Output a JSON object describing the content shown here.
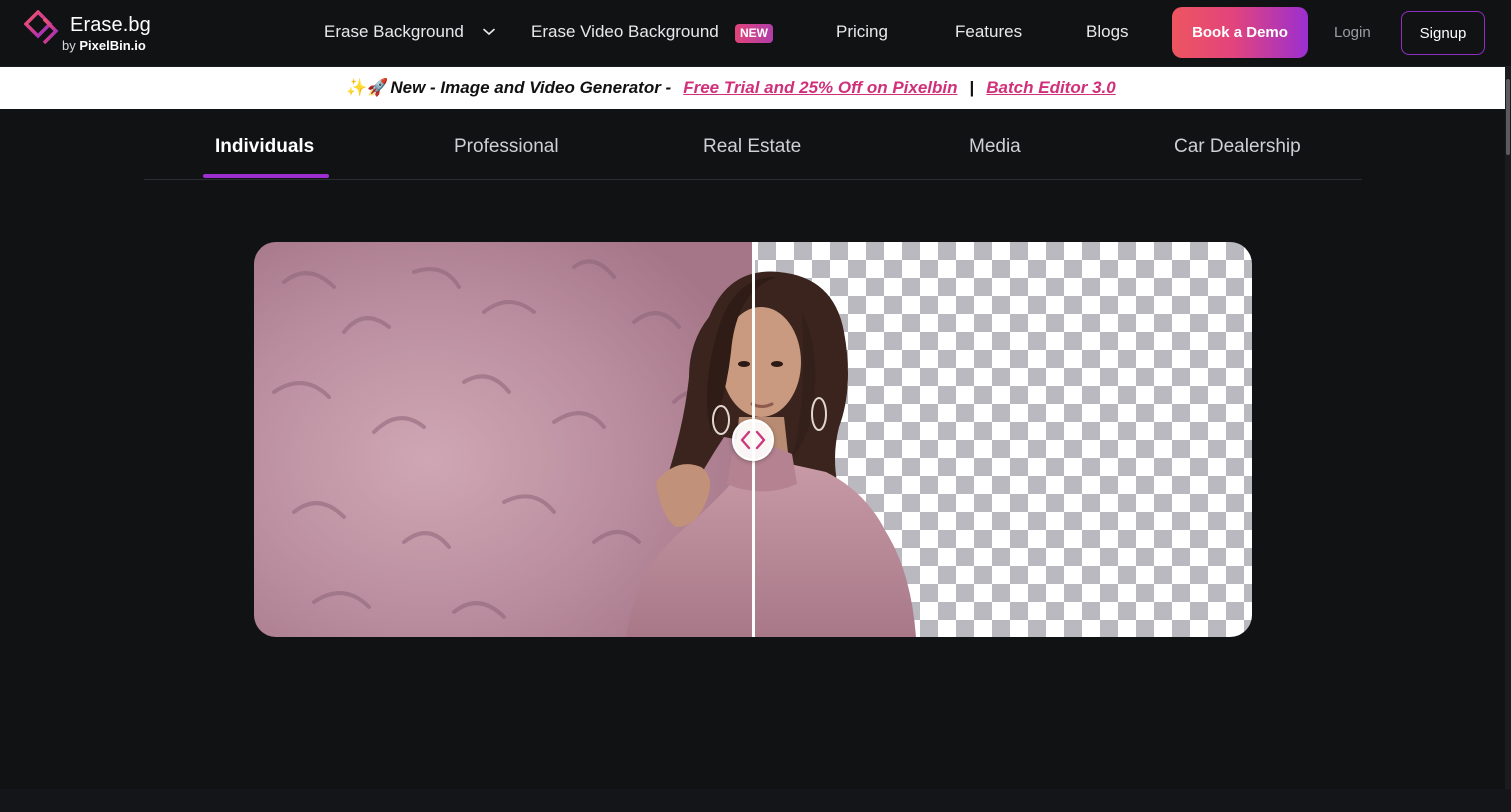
{
  "header": {
    "logo": {
      "title": "Erase.bg",
      "sub_prefix": "by",
      "sub_brand": "PixelBin.io"
    },
    "nav": {
      "erase_background": "Erase Background",
      "erase_video_background": "Erase Video Background",
      "new_badge": "NEW",
      "pricing": "Pricing",
      "features": "Features",
      "blogs": "Blogs"
    },
    "book_demo": "Book a Demo",
    "login": "Login",
    "signup": "Signup"
  },
  "banner": {
    "emoji": "✨🚀",
    "text": "New - Image and Video Generator -",
    "link1": "Free Trial and 25% Off on Pixelbin",
    "separator": "|",
    "link2": "Batch Editor 3.0"
  },
  "tabs": {
    "active_index": 0,
    "items": [
      "Individuals",
      "Professional",
      "Real Estate",
      "Media",
      "Car Dealership"
    ]
  },
  "comparison": {
    "slider_position": 0.5
  },
  "colors": {
    "page_bg": "#111214",
    "accent_purple": "#9b2fd0",
    "accent_pink": "#d0307a",
    "demo_gradient_start": "#ee5560"
  },
  "icons": {
    "logo": "diamond-logo-icon",
    "dropdown": "chevron-down-icon",
    "slider_handle": "arrows-left-right-icon"
  }
}
